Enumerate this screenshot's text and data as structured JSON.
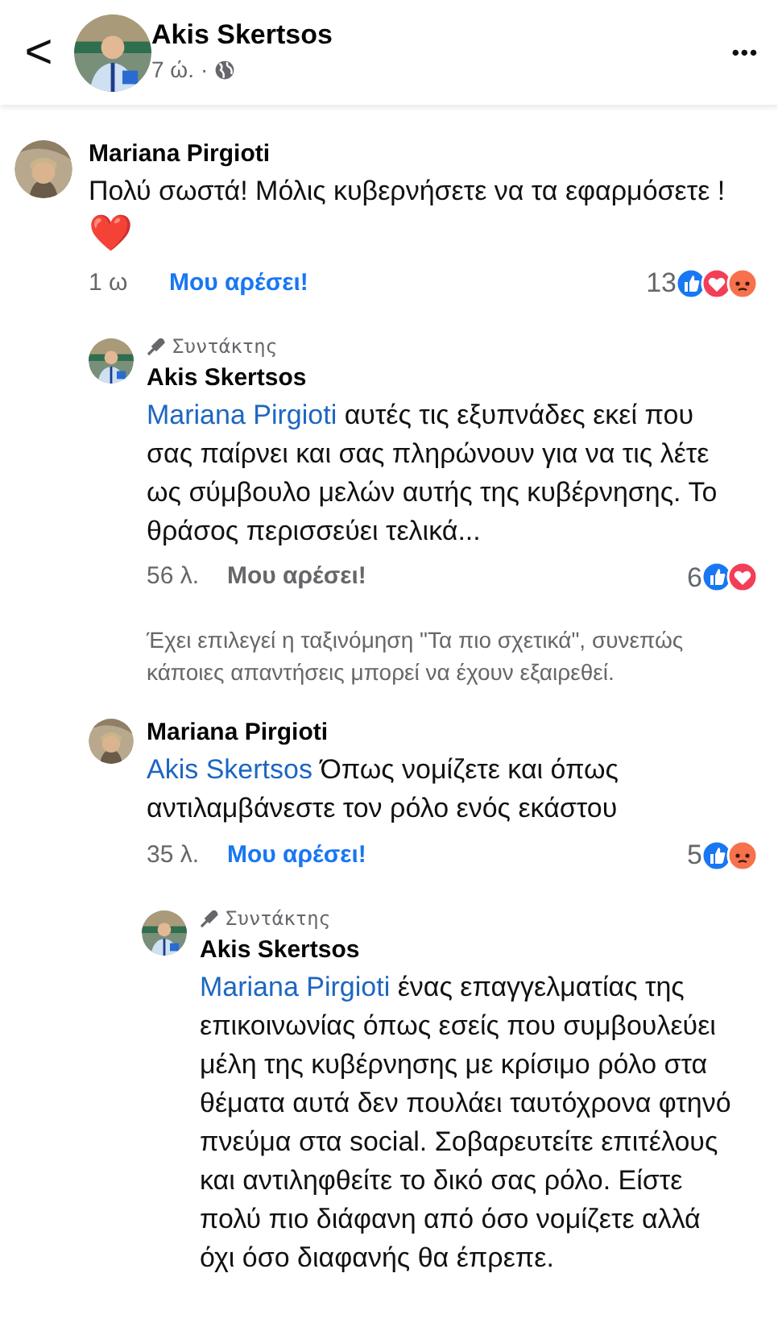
{
  "header": {
    "back": "<",
    "name": "Akis Skertsos",
    "time": "7 ώ.",
    "separator": "·",
    "more": "•••"
  },
  "comments": [
    {
      "author": "Mariana Pirgioti",
      "text": "Πολύ σωστά! Μόλις κυβερνήσετε να τα εφαρμόσετε !",
      "emoji": "❤️",
      "time": "1 ω",
      "like_label": "Μου αρέσει!",
      "liked": true,
      "reaction_count": "13",
      "reactions": [
        {
          "kind": "like"
        },
        {
          "kind": "love"
        },
        {
          "kind": "angry"
        }
      ],
      "children": [
        {
          "author": "Akis Skertsos",
          "badge": "Συντάκτης",
          "mention": "Mariana Pirgioti",
          "text": "αυτές τις εξυπνάδες εκεί που σας παίρνει και σας πληρώνουν για να τις λέτε ως σύμβουλο μελών αυτής της κυβέρνησης. Το θράσος περισσεύει τελικά...",
          "time": "56 λ.",
          "like_label": "Μου αρέσει!",
          "liked": false,
          "reaction_count": "6",
          "reactions": [
            {
              "kind": "like"
            },
            {
              "kind": "love"
            }
          ],
          "notice": "Έχει επιλεγεί η ταξινόμηση \"Τα πιο σχετικά\", συνεπώς κάποιες απαντήσεις μπορεί να έχουν εξαιρεθεί."
        },
        {
          "author": "Mariana Pirgioti",
          "mention": "Akis Skertsos",
          "text": "Όπως νομίζετε και όπως αντιλαμβάνεστε τον ρόλο ενός εκάστου",
          "time": "35 λ.",
          "like_label": "Μου αρέσει!",
          "liked": true,
          "reaction_count": "5",
          "reactions": [
            {
              "kind": "like"
            },
            {
              "kind": "angry"
            }
          ],
          "children": [
            {
              "author": "Akis Skertsos",
              "badge": "Συντάκτης",
              "mention": "Mariana Pirgioti",
              "text": "ένας επαγγελματίας της επικοινωνίας όπως εσείς που συμβουλεύει μέλη της κυβέρνησης με κρίσιμο ρόλο στα θέματα αυτά δεν πουλάει ταυτόχρονα φτηνό πνεύμα στα social. Σοβαρευτείτε επιτέλους και αντιληφθείτε το δικό σας ρόλο. Είστε πολύ πιο διάφανη από όσο νομίζετε αλλά όχι όσο διαφανής θα έπρεπε."
            }
          ]
        }
      ]
    }
  ]
}
